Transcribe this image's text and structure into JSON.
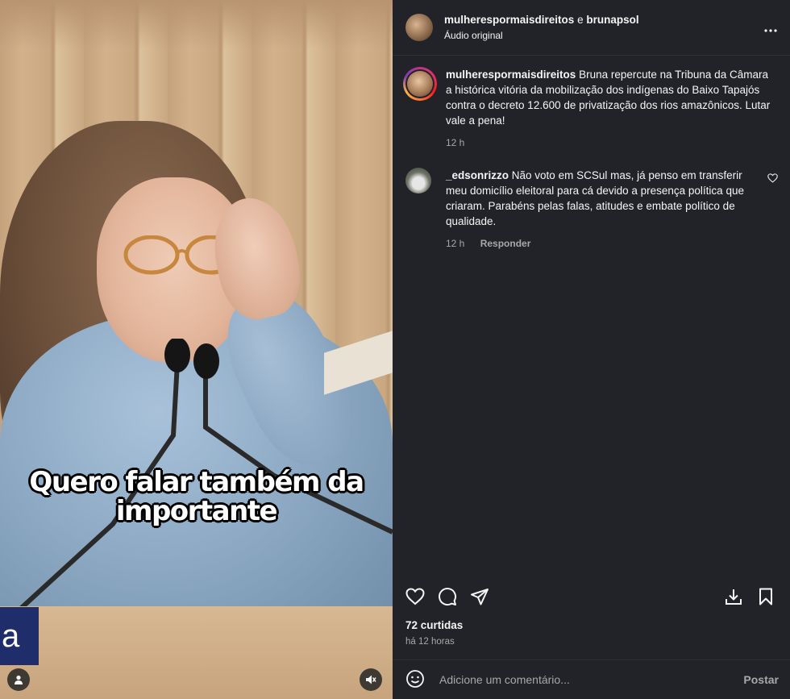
{
  "video": {
    "caption_line1": "Quero falar também da",
    "caption_line2": "importante",
    "overlay_text": "a",
    "user_icon": "user-icon",
    "mute_icon": "speaker-muted-icon"
  },
  "header": {
    "account1": "mulheresp​ormaisdireitos",
    "connector": "e",
    "account2": "brunapsol",
    "audio": "Áudio original",
    "more_icon": "more-icon"
  },
  "post": {
    "username": "mulheresp​ormaisdireitos",
    "caption": "Bruna repercute na Tribuna da Câmara a histórica vitória da mobilização dos indígenas do Baixo Tapajós contra o decreto 12.600 de privatização dos rios amazônicos. Lutar vale a pena!",
    "time": "12 h"
  },
  "comments": [
    {
      "username": "_edsonrizzo",
      "text": "Não voto em SCSul mas, já penso em transferir meu domicílio eleitoral para cá devido a presença política que criaram. Parabéns pelas falas, atitudes e embate político de qualidade.",
      "time": "12 h",
      "reply": "Responder"
    }
  ],
  "footer": {
    "likes": "72 curtidas",
    "ago": "há 12 horas",
    "comment_placeholder": "Adicione um comentário...",
    "post_label": "Postar"
  },
  "colors": {
    "panel_bg": "#212328",
    "muted_text": "#a8a8a8",
    "podium_box": "#1f2d6b"
  }
}
